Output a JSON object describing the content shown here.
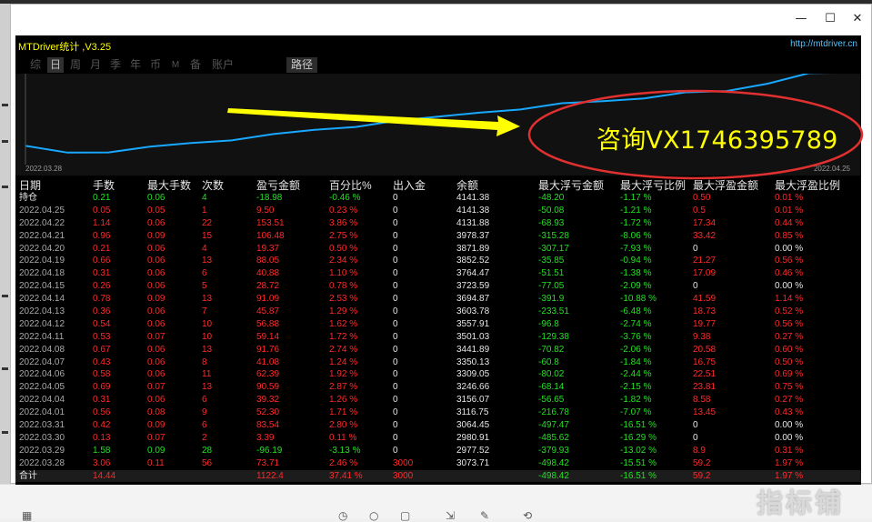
{
  "window": {
    "controls": {
      "minimize": "—",
      "maximize": "☐",
      "close": "✕"
    }
  },
  "app": {
    "title": "MTDriver统计 ,V3.25",
    "url": "http://mtdriver.cn",
    "tabs": [
      "综",
      "日",
      "周",
      "月",
      "季",
      "年",
      "币",
      "M",
      "备",
      "账户"
    ],
    "active_tab": "日",
    "path_button": "路径"
  },
  "chart_data": {
    "type": "line",
    "x_start_label": "2022.03.28",
    "x_end_label": "2022.04.25",
    "x": [
      "2022.03.28",
      "2022.03.29",
      "2022.03.30",
      "2022.03.31",
      "2022.04.01",
      "2022.04.04",
      "2022.04.05",
      "2022.04.06",
      "2022.04.07",
      "2022.04.08",
      "2022.04.11",
      "2022.04.12",
      "2022.04.13",
      "2022.04.14",
      "2022.04.15",
      "2022.04.18",
      "2022.04.19",
      "2022.04.20",
      "2022.04.21",
      "2022.04.22",
      "2022.04.25"
    ],
    "series": [
      {
        "values": [
          3073.71,
          2977.52,
          2980.91,
          3064.45,
          3116.75,
          3156.07,
          3246.66,
          3309.05,
          3350.13,
          3441.89,
          3501.03,
          3557.91,
          3603.78,
          3694.87,
          3723.59,
          3764.47,
          3852.52,
          3871.89,
          3978.37,
          4131.88,
          4141.38
        ],
        "color": "#18a8ff"
      }
    ],
    "color_line": "#18a8ff",
    "grid": false
  },
  "table": {
    "headers": [
      "日期",
      "手数",
      "最大手数",
      "次数",
      "盈亏金额",
      "百分比%",
      "出入金",
      "余额",
      "最大浮亏金额",
      "最大浮亏比例",
      "最大浮盈金额",
      "最大浮盈比例"
    ],
    "rows": [
      {
        "date": "持仓",
        "lots": "0.21",
        "max_lots": "0.06",
        "count": "4",
        "pnl": "-18.98",
        "pct": "-0.46 %",
        "inout": "0",
        "balance": "4141.38",
        "max_dd": "-48.20",
        "max_dd_pct": "-1.17 %",
        "max_fp": "0.50",
        "max_fp_pct": "0.01 %",
        "holding": true
      },
      {
        "date": "2022.04.25",
        "lots": "0.05",
        "max_lots": "0.05",
        "count": "1",
        "pnl": "9.50",
        "pct": "0.23 %",
        "inout": "0",
        "balance": "4141.38",
        "max_dd": "-50.08",
        "max_dd_pct": "-1.21 %",
        "max_fp": "0.5",
        "max_fp_pct": "0.01 %"
      },
      {
        "date": "2022.04.22",
        "lots": "1.14",
        "max_lots": "0.06",
        "count": "22",
        "pnl": "153.51",
        "pct": "3.86 %",
        "inout": "0",
        "balance": "4131.88",
        "max_dd": "-68.93",
        "max_dd_pct": "-1.72 %",
        "max_fp": "17.34",
        "max_fp_pct": "0.44 %"
      },
      {
        "date": "2022.04.21",
        "lots": "0.96",
        "max_lots": "0.09",
        "count": "15",
        "pnl": "106.48",
        "pct": "2.75 %",
        "inout": "0",
        "balance": "3978.37",
        "max_dd": "-315.28",
        "max_dd_pct": "-8.06 %",
        "max_fp": "33.42",
        "max_fp_pct": "0.85 %"
      },
      {
        "date": "2022.04.20",
        "lots": "0.21",
        "max_lots": "0.06",
        "count": "4",
        "pnl": "19.37",
        "pct": "0.50 %",
        "inout": "0",
        "balance": "3871.89",
        "max_dd": "-307.17",
        "max_dd_pct": "-7.93 %",
        "max_fp": "0",
        "max_fp_pct": "0.00 %"
      },
      {
        "date": "2022.04.19",
        "lots": "0.66",
        "max_lots": "0.06",
        "count": "13",
        "pnl": "88.05",
        "pct": "2.34 %",
        "inout": "0",
        "balance": "3852.52",
        "max_dd": "-35.85",
        "max_dd_pct": "-0.94 %",
        "max_fp": "21.27",
        "max_fp_pct": "0.56 %"
      },
      {
        "date": "2022.04.18",
        "lots": "0.31",
        "max_lots": "0.06",
        "count": "6",
        "pnl": "40.88",
        "pct": "1.10 %",
        "inout": "0",
        "balance": "3764.47",
        "max_dd": "-51.51",
        "max_dd_pct": "-1.38 %",
        "max_fp": "17.09",
        "max_fp_pct": "0.46 %"
      },
      {
        "date": "2022.04.15",
        "lots": "0.26",
        "max_lots": "0.06",
        "count": "5",
        "pnl": "28.72",
        "pct": "0.78 %",
        "inout": "0",
        "balance": "3723.59",
        "max_dd": "-77.05",
        "max_dd_pct": "-2.09 %",
        "max_fp": "0",
        "max_fp_pct": "0.00 %"
      },
      {
        "date": "2022.04.14",
        "lots": "0.78",
        "max_lots": "0.09",
        "count": "13",
        "pnl": "91.09",
        "pct": "2.53 %",
        "inout": "0",
        "balance": "3694.87",
        "max_dd": "-391.9",
        "max_dd_pct": "-10.88 %",
        "max_fp": "41.59",
        "max_fp_pct": "1.14 %"
      },
      {
        "date": "2022.04.13",
        "lots": "0.36",
        "max_lots": "0.06",
        "count": "7",
        "pnl": "45.87",
        "pct": "1.29 %",
        "inout": "0",
        "balance": "3603.78",
        "max_dd": "-233.51",
        "max_dd_pct": "-6.48 %",
        "max_fp": "18.73",
        "max_fp_pct": "0.52 %"
      },
      {
        "date": "2022.04.12",
        "lots": "0.54",
        "max_lots": "0.06",
        "count": "10",
        "pnl": "56.88",
        "pct": "1.62 %",
        "inout": "0",
        "balance": "3557.91",
        "max_dd": "-96.8",
        "max_dd_pct": "-2.74 %",
        "max_fp": "19.77",
        "max_fp_pct": "0.56 %"
      },
      {
        "date": "2022.04.11",
        "lots": "0.53",
        "max_lots": "0.07",
        "count": "10",
        "pnl": "59.14",
        "pct": "1.72 %",
        "inout": "0",
        "balance": "3501.03",
        "max_dd": "-129.38",
        "max_dd_pct": "-3.76 %",
        "max_fp": "9.38",
        "max_fp_pct": "0.27 %"
      },
      {
        "date": "2022.04.08",
        "lots": "0.67",
        "max_lots": "0.06",
        "count": "13",
        "pnl": "91.76",
        "pct": "2.74 %",
        "inout": "0",
        "balance": "3441.89",
        "max_dd": "-70.82",
        "max_dd_pct": "-2.06 %",
        "max_fp": "20.58",
        "max_fp_pct": "0.60 %"
      },
      {
        "date": "2022.04.07",
        "lots": "0.43",
        "max_lots": "0.06",
        "count": "8",
        "pnl": "41.08",
        "pct": "1.24 %",
        "inout": "0",
        "balance": "3350.13",
        "max_dd": "-60.8",
        "max_dd_pct": "-1.84 %",
        "max_fp": "16.75",
        "max_fp_pct": "0.50 %"
      },
      {
        "date": "2022.04.06",
        "lots": "0.58",
        "max_lots": "0.06",
        "count": "11",
        "pnl": "62.39",
        "pct": "1.92 %",
        "inout": "0",
        "balance": "3309.05",
        "max_dd": "-80.02",
        "max_dd_pct": "-2.44 %",
        "max_fp": "22.51",
        "max_fp_pct": "0.69 %"
      },
      {
        "date": "2022.04.05",
        "lots": "0.69",
        "max_lots": "0.07",
        "count": "13",
        "pnl": "90.59",
        "pct": "2.87 %",
        "inout": "0",
        "balance": "3246.66",
        "max_dd": "-68.14",
        "max_dd_pct": "-2.15 %",
        "max_fp": "23.81",
        "max_fp_pct": "0.75 %"
      },
      {
        "date": "2022.04.04",
        "lots": "0.31",
        "max_lots": "0.06",
        "count": "6",
        "pnl": "39.32",
        "pct": "1.26 %",
        "inout": "0",
        "balance": "3156.07",
        "max_dd": "-56.65",
        "max_dd_pct": "-1.82 %",
        "max_fp": "8.58",
        "max_fp_pct": "0.27 %"
      },
      {
        "date": "2022.04.01",
        "lots": "0.56",
        "max_lots": "0.08",
        "count": "9",
        "pnl": "52.30",
        "pct": "1.71 %",
        "inout": "0",
        "balance": "3116.75",
        "max_dd": "-216.78",
        "max_dd_pct": "-7.07 %",
        "max_fp": "13.45",
        "max_fp_pct": "0.43 %"
      },
      {
        "date": "2022.03.31",
        "lots": "0.42",
        "max_lots": "0.09",
        "count": "6",
        "pnl": "83.54",
        "pct": "2.80 %",
        "inout": "0",
        "balance": "3064.45",
        "max_dd": "-497.47",
        "max_dd_pct": "-16.51 %",
        "max_fp": "0",
        "max_fp_pct": "0.00 %"
      },
      {
        "date": "2022.03.30",
        "lots": "0.13",
        "max_lots": "0.07",
        "count": "2",
        "pnl": "3.39",
        "pct": "0.11 %",
        "inout": "0",
        "balance": "2980.91",
        "max_dd": "-485.62",
        "max_dd_pct": "-16.29 %",
        "max_fp": "0",
        "max_fp_pct": "0.00 %"
      },
      {
        "date": "2022.03.29",
        "lots": "1.58",
        "max_lots": "0.09",
        "count": "28",
        "pnl": "-96.19",
        "pct": "-3.13 %",
        "inout": "0",
        "balance": "2977.52",
        "max_dd": "-379.93",
        "max_dd_pct": "-13.02 %",
        "max_fp": "8.9",
        "max_fp_pct": "0.31 %",
        "negative": true
      },
      {
        "date": "2022.03.28",
        "lots": "3.06",
        "max_lots": "0.11",
        "count": "56",
        "pnl": "73.71",
        "pct": "2.46 %",
        "inout": "3000",
        "balance": "3073.71",
        "max_dd": "-498.42",
        "max_dd_pct": "-15.51 %",
        "max_fp": "59.2",
        "max_fp_pct": "1.97 %"
      }
    ],
    "total": {
      "date": "合计",
      "lots": "14.44",
      "max_lots": "",
      "count": "",
      "pnl": "1122.4",
      "pct": "37.41 %",
      "inout": "3000",
      "balance": "",
      "max_dd": "-498.42",
      "max_dd_pct": "-16.51 %",
      "max_fp": "59.2",
      "max_fp_pct": "1.97 %"
    }
  },
  "annotation": {
    "text": "咨询VX1746395789",
    "arrow_color": "#ffff00",
    "ellipse_color": "#e03030"
  },
  "watermark": "指标铺"
}
